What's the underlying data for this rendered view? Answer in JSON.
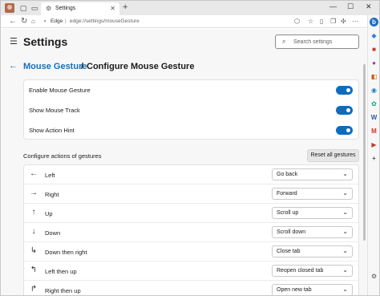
{
  "browser": {
    "tab_title": "Settings",
    "brand": "Edge",
    "separator": "|",
    "url": "edge://settings/mouseGesture"
  },
  "header": {
    "title": "Settings",
    "search_placeholder": "Search settings"
  },
  "breadcrumb": {
    "parent": "Mouse Gesture",
    "separator": "/",
    "current": "Configure Mouse Gesture"
  },
  "toggles": [
    {
      "label": "Enable Mouse Gesture",
      "on": true
    },
    {
      "label": "Show Mouse Track",
      "on": true
    },
    {
      "label": "Show Action Hint",
      "on": true
    }
  ],
  "gestures_section": {
    "title": "Configure actions of gestures",
    "reset_label": "Reset all gestures",
    "rows": [
      {
        "icon": "arrow-left-icon",
        "glyph": "←",
        "name": "Left",
        "action": "Go back"
      },
      {
        "icon": "arrow-right-icon",
        "glyph": "→",
        "name": "Right",
        "action": "Forward"
      },
      {
        "icon": "arrow-up-icon",
        "glyph": "↑",
        "name": "Up",
        "action": "Scroll up"
      },
      {
        "icon": "arrow-down-icon",
        "glyph": "↓",
        "name": "Down",
        "action": "Scroll down"
      },
      {
        "icon": "down-then-right-icon",
        "glyph": "↳",
        "name": "Down then right",
        "action": "Close tab"
      },
      {
        "icon": "left-then-up-icon",
        "glyph": "↰",
        "name": "Left then up",
        "action": "Reopen closed tab"
      },
      {
        "icon": "right-then-up-icon",
        "glyph": "↱",
        "name": "Right then up",
        "action": "Open new tab"
      }
    ]
  },
  "colors": {
    "accent": "#0f6cbd",
    "link": "#1a6fb8"
  }
}
